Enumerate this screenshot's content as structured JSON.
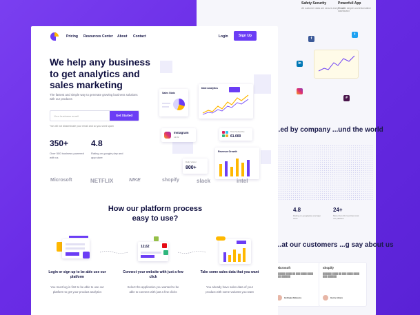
{
  "nav": {
    "links": [
      "Pricing",
      "Resources Center",
      "About",
      "Contact"
    ],
    "login": "Login",
    "signup": "Sign Up"
  },
  "hero": {
    "title": "We help any business to get analytics and sales marketing",
    "description": "The fastest and simple way to generate growing business solutions with our products",
    "email_placeholder": "Your business email",
    "cta": "Get Started",
    "disclaimer": "*we will not disseminate your email and so you sned spam"
  },
  "stats": [
    {
      "value": "350+",
      "label": "Over 500 business powered with us"
    },
    {
      "value": "4.8",
      "label": "Rating on google play and app store"
    }
  ],
  "dashboard": {
    "sales_stats": "Sales Stats",
    "data_analytics": "Date Analytics",
    "instagram_label": "Instagram",
    "instagram_value": "12.82",
    "total_subscribe_label": "Total Subscribe",
    "total_subscribe_value": "61.000",
    "revenue_growth": "Revenue Growth",
    "daily_visitor_label": "Daily Visitor",
    "daily_visitor_value": "800+"
  },
  "brand_logos": [
    "Microsoft",
    "NETFLIX",
    "NIKE",
    "shopify",
    "slack",
    "intel"
  ],
  "process": {
    "title": "How our platform process easy to use?",
    "steps": [
      {
        "title": "Login or sign up to be able use our platform",
        "desc": "You must log in first to be able to use our platform to get your product analytics"
      },
      {
        "title": "Connect your website with just a few click",
        "desc": "Select the application you wanted to be able to connect with just a few clicks"
      },
      {
        "title": "Take some sales data that you want",
        "desc": "You already have sales data of your product with some variants you want"
      }
    ],
    "card_value": "12,62"
  },
  "background_page": {
    "features": [
      {
        "title": "Safety Security",
        "sub": "All customer data are secure and private"
      },
      {
        "title": "Powerfull App",
        "sub": "Provide simple and informative dashboard"
      }
    ],
    "heading": "...ed by company ...und the world",
    "stats": [
      {
        "value": "4.8",
        "sub": "Rating on googleplay and app store"
      },
      {
        "value": "24+",
        "sub": "More than 20 countries trust our platform"
      }
    ],
    "customers_heading": "...at our customers ...g say about us",
    "cards": [
      {
        "brand": "Microsoft",
        "person": "Cyhnqia Rebecca"
      },
      {
        "brand": "shopify",
        "person": "Gerry Alvaro"
      }
    ]
  },
  "colors": {
    "primary": "#6b3df5",
    "accent": "#ffb800",
    "background": "#7a3ff0"
  }
}
